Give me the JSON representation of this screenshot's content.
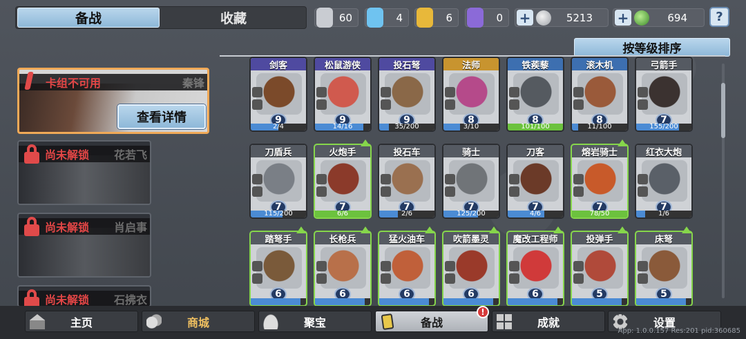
{
  "top_tabs": {
    "active": "备战",
    "inactive": "收藏"
  },
  "resources": [
    {
      "name": "silver-shard",
      "value": "60",
      "color": "#c9ccd2"
    },
    {
      "name": "blue-shard",
      "value": "4",
      "color": "#6fc3f0"
    },
    {
      "name": "gold-shard",
      "value": "6",
      "color": "#e8b83a"
    },
    {
      "name": "purple-shard",
      "value": "0",
      "color": "#8b6ad8"
    }
  ],
  "currency": [
    {
      "name": "silver-coin",
      "value": "5213",
      "color": "#c4c7cc"
    },
    {
      "name": "green-gem",
      "value": "694",
      "color": "#5fb847"
    }
  ],
  "help_label": "?",
  "sort_label": "按等级排序",
  "deck_slots": [
    {
      "status": "卡组不可用",
      "hero": "秦锋",
      "button": "查看详情"
    },
    {
      "status": "尚未解锁",
      "hero": "花若飞"
    },
    {
      "status": "尚未解锁",
      "hero": "肖启事"
    },
    {
      "status": "尚未解锁",
      "hero": "石拂衣"
    }
  ],
  "cards": [
    {
      "name": "剑客",
      "level": "9",
      "progress": "2/4",
      "fill": 0.5,
      "hdr": "#4f4aa0",
      "art": "#7b4a2a",
      "upgrade": false
    },
    {
      "name": "松鼠游侠",
      "level": "9",
      "progress": "14/16",
      "fill": 0.875,
      "hdr": "#4f4aa0",
      "art": "#d05a4e",
      "upgrade": false
    },
    {
      "name": "投石弩",
      "level": "9",
      "progress": "35/200",
      "fill": 0.175,
      "hdr": "#4f4aa0",
      "art": "#8a6848",
      "upgrade": false
    },
    {
      "name": "法师",
      "level": "8",
      "progress": "3/10",
      "fill": 0.3,
      "hdr": "#c8942f",
      "art": "#b54a8a",
      "upgrade": false
    },
    {
      "name": "铁蒺藜",
      "level": "8",
      "progress": "101/100",
      "fill": 1.0,
      "hdr": "#3d6fb0",
      "art": "#555a60",
      "upgrade": false
    },
    {
      "name": "滚木机",
      "level": "8",
      "progress": "11/100",
      "fill": 0.11,
      "hdr": "#3d6fb0",
      "art": "#9a5a3a",
      "upgrade": false
    },
    {
      "name": "弓箭手",
      "level": "7",
      "progress": "155/200",
      "fill": 0.775,
      "hdr": "#555a62",
      "art": "#3b3230",
      "upgrade": false
    },
    {
      "name": "刀盾兵",
      "level": "7",
      "progress": "115/200",
      "fill": 0.575,
      "hdr": "#555a62",
      "art": "#7a7f86",
      "upgrade": false
    },
    {
      "name": "火炮手",
      "level": "7",
      "progress": "6/6",
      "fill": 1.0,
      "hdr": "#555a62",
      "art": "#8b3a2a",
      "upgrade": true
    },
    {
      "name": "投石车",
      "level": "7",
      "progress": "2/6",
      "fill": 0.333,
      "hdr": "#555a62",
      "art": "#9a7050",
      "upgrade": false
    },
    {
      "name": "骑士",
      "level": "7",
      "progress": "125/200",
      "fill": 0.625,
      "hdr": "#555a62",
      "art": "#707478",
      "upgrade": false
    },
    {
      "name": "刀客",
      "level": "7",
      "progress": "4/6",
      "fill": 0.667,
      "hdr": "#555a62",
      "art": "#6b3a28",
      "upgrade": false
    },
    {
      "name": "熔岩骑士",
      "level": "7",
      "progress": "78/50",
      "fill": 1.0,
      "hdr": "#555a62",
      "art": "#c85a2a",
      "upgrade": true
    },
    {
      "name": "红衣大炮",
      "level": "7",
      "progress": "1/6",
      "fill": 0.167,
      "hdr": "#555a62",
      "art": "#5a6068",
      "upgrade": false
    },
    {
      "name": "踏弩手",
      "level": "6",
      "progress": "",
      "fill": 0.9,
      "hdr": "#555a62",
      "art": "#7a5a3a",
      "upgrade": true
    },
    {
      "name": "长枪兵",
      "level": "6",
      "progress": "",
      "fill": 0.9,
      "hdr": "#555a62",
      "art": "#b8704a",
      "upgrade": true
    },
    {
      "name": "猛火油车",
      "level": "6",
      "progress": "",
      "fill": 0.9,
      "hdr": "#555a62",
      "art": "#c0603a",
      "upgrade": true
    },
    {
      "name": "吹箭墨灵",
      "level": "6",
      "progress": "",
      "fill": 0.9,
      "hdr": "#555a62",
      "art": "#9a3a2a",
      "upgrade": true
    },
    {
      "name": "魔改工程师",
      "level": "6",
      "progress": "",
      "fill": 0.9,
      "hdr": "#555a62",
      "art": "#d03a3a",
      "upgrade": true
    },
    {
      "name": "投弹手",
      "level": "5",
      "progress": "",
      "fill": 0.9,
      "hdr": "#555a62",
      "art": "#b04a3a",
      "upgrade": true
    },
    {
      "name": "床弩",
      "level": "5",
      "progress": "",
      "fill": 0.9,
      "hdr": "#555a62",
      "art": "#8a5a3a",
      "upgrade": true
    }
  ],
  "nav": [
    {
      "name": "home",
      "label": "主页",
      "active": false
    },
    {
      "name": "shop",
      "label": "商城",
      "active": false,
      "label_color": "#f0c060"
    },
    {
      "name": "treasure",
      "label": "聚宝",
      "active": false
    },
    {
      "name": "battle-prep",
      "label": "备战",
      "active": true
    },
    {
      "name": "achievements",
      "label": "成就",
      "active": false
    },
    {
      "name": "settings",
      "label": "设置",
      "active": false
    }
  ],
  "nav_badge": "!",
  "version": "App: 1.0.0.157 Res:201 pid:360685"
}
